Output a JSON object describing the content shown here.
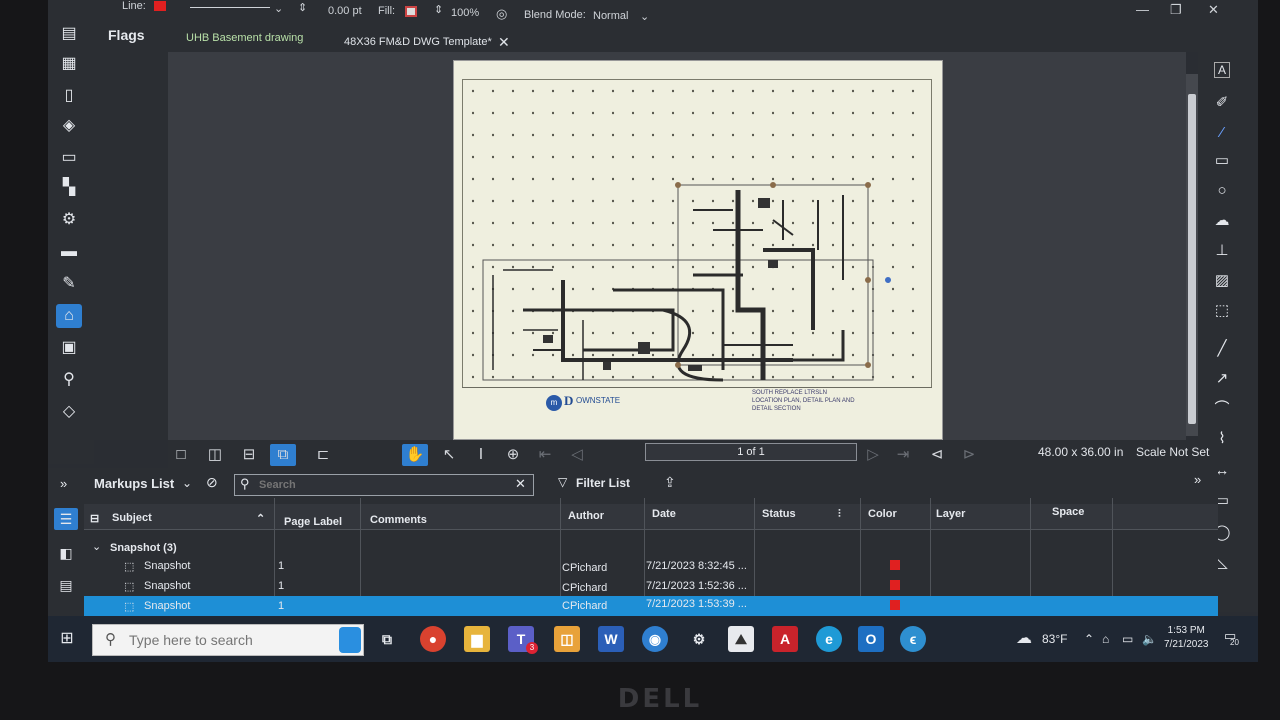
{
  "props": {
    "line_label": "Line:",
    "thickness": "0.00 pt",
    "fill_label": "Fill:",
    "opacity": "100%",
    "blend_label": "Blend Mode:",
    "blend_value": "Normal",
    "line_color": "#e02020"
  },
  "window": {
    "minimize": "—",
    "restore": "❐",
    "close": "✕"
  },
  "panel_title": "Flags",
  "tabs": [
    {
      "label": "UHB Basement drawing"
    },
    {
      "label": "48X36 FM&D DWG Template*"
    }
  ],
  "drawing": {
    "logo_letter": "D",
    "logo_text": "OWNSTATE",
    "tb1": "SOUTH REPLACE LTRSLN",
    "tb2": "LOCATION PLAN, DETAIL PLAN AND",
    "tb3": "DETAIL SECTION"
  },
  "nav": {
    "page": "1 of 1",
    "page_size": "48.00 x 36.00 in",
    "scale": "Scale Not Set"
  },
  "markups": {
    "title": "Markups List",
    "search_placeholder": "Search",
    "filter_label": "Filter List",
    "columns": {
      "subject": "Subject",
      "page_label": "Page Label",
      "comments": "Comments",
      "author": "Author",
      "date": "Date",
      "status": "Status",
      "color": "Color",
      "layer": "Layer",
      "space": "Space"
    },
    "group": "Snapshot (3)",
    "rows": [
      {
        "subject": "Snapshot",
        "page": "1",
        "author": "CPichard",
        "date": "7/21/2023 8:32:45 ..."
      },
      {
        "subject": "Snapshot",
        "page": "1",
        "author": "CPichard",
        "date": "7/21/2023 1:52:36 ..."
      },
      {
        "subject": "Snapshot",
        "page": "1",
        "author": "CPichard",
        "date": "7/21/2023 1:53:39 ..."
      }
    ],
    "row_color": "#e02020"
  },
  "taskbar": {
    "search_placeholder": "Type here to search",
    "weather": "83°F",
    "time": "1:53 PM",
    "date": "7/21/2023",
    "notifications": "20",
    "teams_badge": "3"
  }
}
